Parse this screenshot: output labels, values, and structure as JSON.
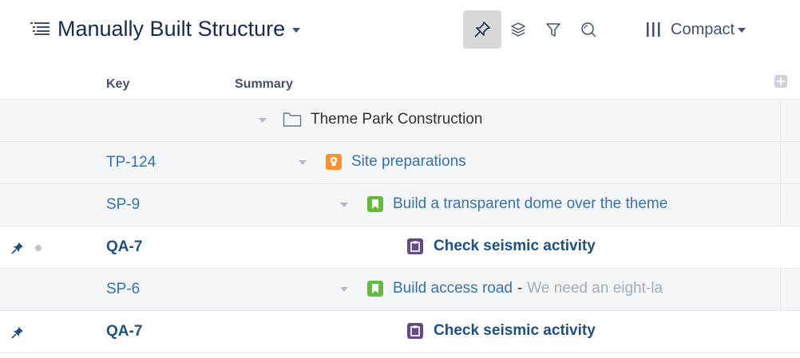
{
  "header": {
    "title": "Manually Built Structure",
    "view_label": "Compact",
    "tools": [
      {
        "name": "pin-tool",
        "icon": "pin-icon",
        "active": true
      },
      {
        "name": "layers-tool",
        "icon": "layers-icon",
        "active": false
      },
      {
        "name": "filter-tool",
        "icon": "filter-icon",
        "active": false
      },
      {
        "name": "search-tool",
        "icon": "search-icon",
        "active": false
      }
    ]
  },
  "table": {
    "columns": [
      "Key",
      "Summary"
    ],
    "rows": [
      {
        "key": "",
        "summary": "Theme Park Construction",
        "type": "folder",
        "depth": 0,
        "pinned": false
      },
      {
        "key": "TP-124",
        "summary": "Site preparations",
        "type": "idea",
        "depth": 1,
        "pinned": false
      },
      {
        "key": "SP-9",
        "summary": "Build a transparent dome over the theme",
        "type": "story",
        "depth": 2,
        "pinned": false
      },
      {
        "key": "QA-7",
        "summary": "Check seismic activity",
        "type": "task",
        "depth": 3,
        "pinned": true,
        "dot": true
      },
      {
        "key": "SP-6",
        "summary": "Build access road",
        "desc": "We need an eight-la",
        "type": "story",
        "depth": 2,
        "pinned": false
      },
      {
        "key": "QA-7",
        "summary": "Check seismic activity",
        "type": "task",
        "depth": 3,
        "pinned": true,
        "dot": false
      }
    ]
  },
  "colors": {
    "link": "#3572b0",
    "link_bold": "#205081",
    "idea_icon": "#f79232",
    "story_icon": "#63ba3c",
    "task_icon": "#654982",
    "row_gray": "#f5f6f7"
  }
}
